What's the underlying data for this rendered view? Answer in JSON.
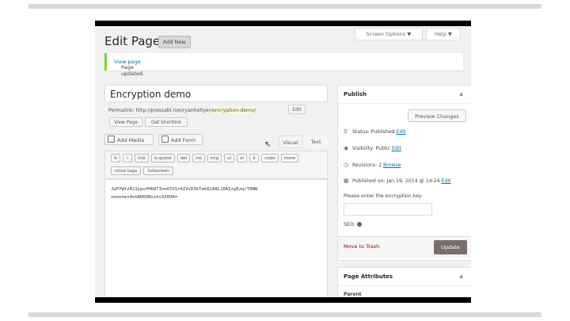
{
  "header": {
    "title": "Edit Page",
    "add_new": "Add New",
    "screen_options": "Screen Options ▼",
    "help": "Help ▼"
  },
  "notice": {
    "text": "Page updated.",
    "link": "View page"
  },
  "post": {
    "title": "Encryption demo",
    "permalink_label": "Permalink:",
    "permalink_base": "http://pressabl.net/ryanhellyer/",
    "permalink_slug": "encryption-demo",
    "permalink_end": "/",
    "edit_button": "Edit",
    "view_page_button": "View Page",
    "get_shortlink_button": "Get Shortlink"
  },
  "editor": {
    "add_media": "Add Media",
    "add_form": "Add Form",
    "tab_visual": "Visual",
    "tab_text": "Text",
    "quicktags": [
      "b",
      "i",
      "link",
      "b-quote",
      "del",
      "ins",
      "img",
      "ul",
      "ol",
      "li",
      "code",
      "more",
      "close tags",
      "fullscreen"
    ],
    "content": "JwFYWfzR21LpuYH687InmV5SSrAIVvD3kTek62A8L1DAIzgEzqrT8NW\noeonnes0ok8OKXNszhvSX09A="
  },
  "publish": {
    "title": "Publish",
    "preview_changes": "Preview Changes",
    "status_label": "Status: Published",
    "status_edit": "Edit",
    "visibility_label": "Visibility: Public",
    "visibility_edit": "Edit",
    "revisions_label": "Revisions: 2",
    "revisions_browse": "Browse",
    "published_label": "Published on: Jan 19, 2014 @ 14:24",
    "published_edit": "Edit",
    "encryption_prompt": "Please enter the encryption key",
    "seo_label": "SEO:",
    "move_to_trash": "Move to Trash",
    "update": "Update"
  },
  "page_attributes": {
    "title": "Page Attributes",
    "parent_label": "Parent"
  },
  "colors": {
    "accent": "#0073aa",
    "notice_border": "#7ad03a",
    "update_button": "#7a6e6a",
    "trash": "#a00000"
  }
}
